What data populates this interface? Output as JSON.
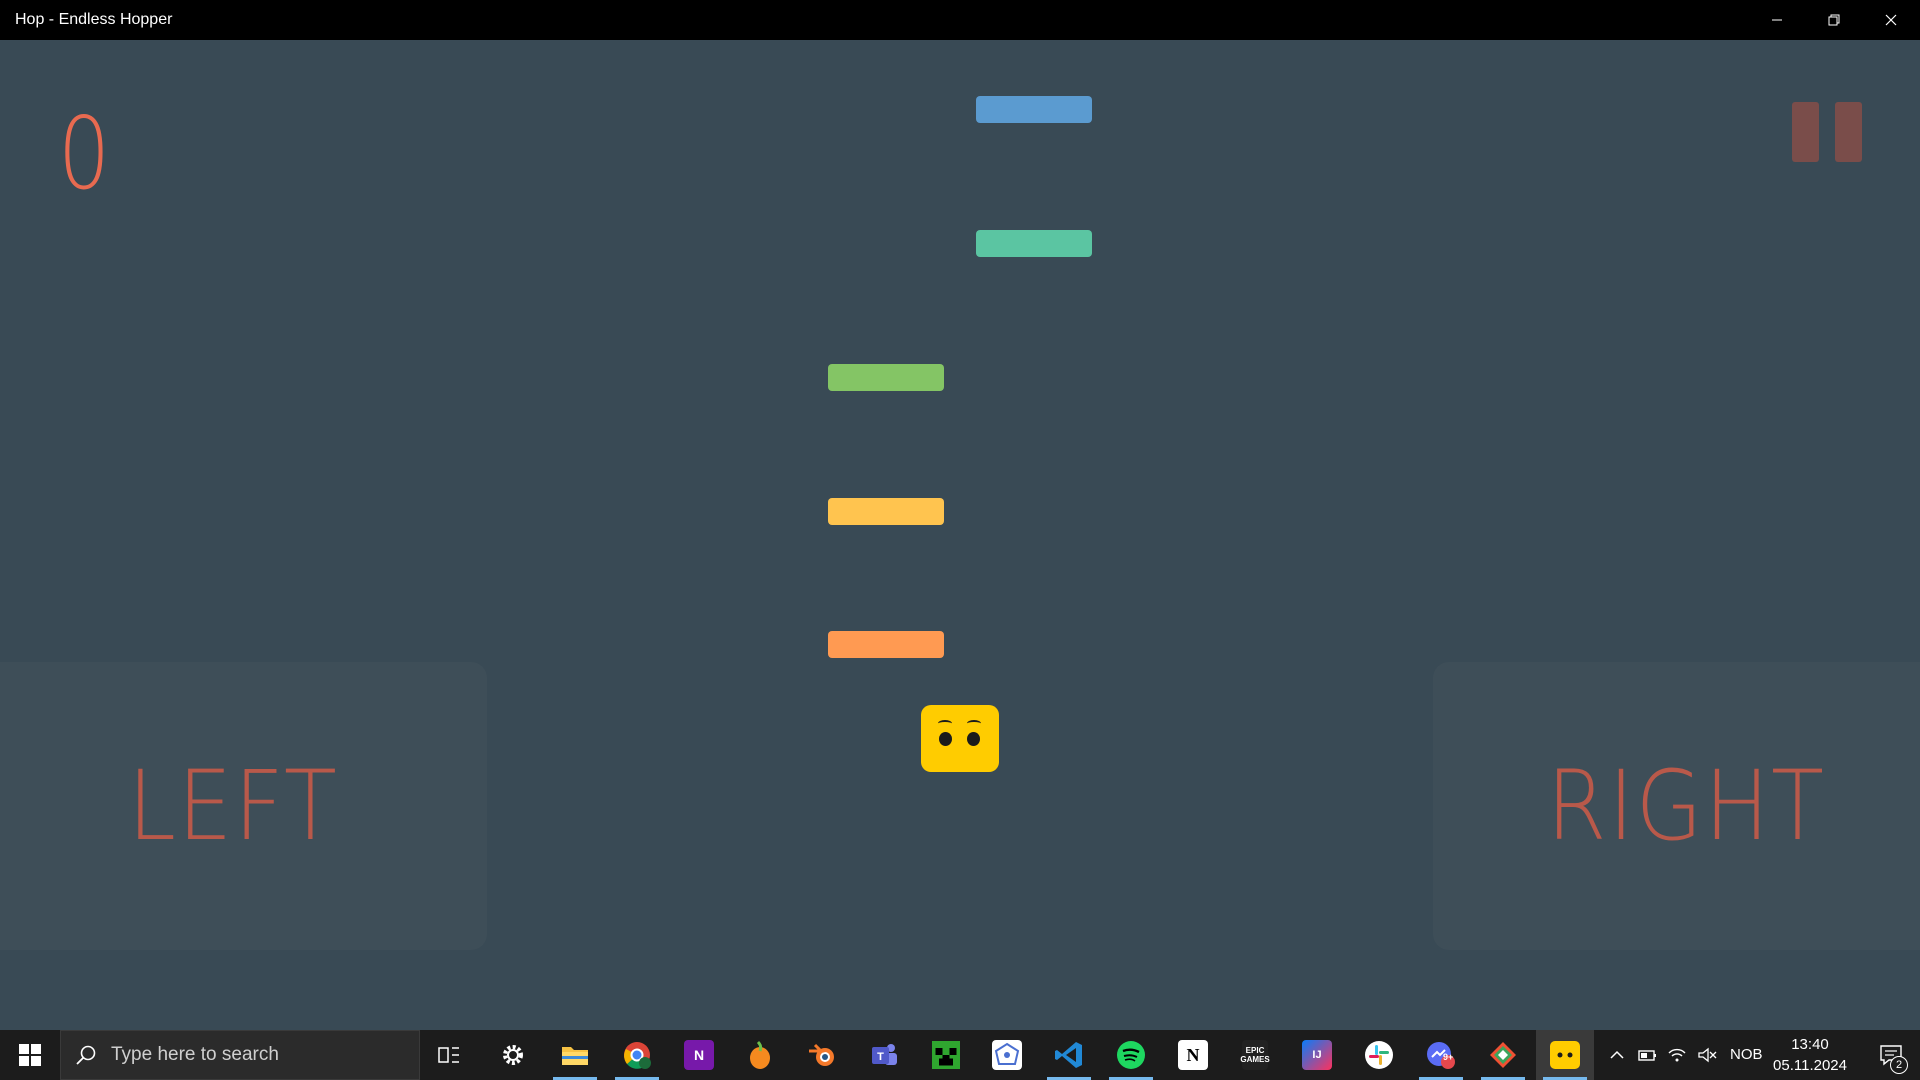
{
  "window": {
    "title": "Hop - Endless Hopper",
    "minimize_icon": "minimize-icon",
    "restore_icon": "restore-icon",
    "close_icon": "close-icon"
  },
  "game": {
    "score": "0",
    "pause_icon": "pause-icon",
    "left_label": "LEFT",
    "right_label": "RIGHT",
    "background_color": "#394a55",
    "platforms": [
      {
        "color": "#5b9bd0"
      },
      {
        "color": "#5bc5a2"
      },
      {
        "color": "#84c565"
      },
      {
        "color": "#ffc44f"
      },
      {
        "color": "#ff9a52"
      }
    ],
    "player_color": "#ffcc00"
  },
  "taskbar": {
    "search_placeholder": "Type here to search",
    "apps": [
      {
        "name": "task-view",
        "label": ""
      },
      {
        "name": "settings",
        "label": ""
      },
      {
        "name": "file-explorer",
        "label": ""
      },
      {
        "name": "chrome",
        "label": ""
      },
      {
        "name": "onenote",
        "label": "N"
      },
      {
        "name": "fl-studio",
        "label": ""
      },
      {
        "name": "blender",
        "label": ""
      },
      {
        "name": "teams",
        "label": ""
      },
      {
        "name": "minecraft",
        "label": ""
      },
      {
        "name": "app-polygon",
        "label": ""
      },
      {
        "name": "vscode",
        "label": ""
      },
      {
        "name": "spotify",
        "label": ""
      },
      {
        "name": "notion",
        "label": "N"
      },
      {
        "name": "epic-games",
        "label": "EPIC GAMES"
      },
      {
        "name": "intellij",
        "label": "IJ"
      },
      {
        "name": "slack",
        "label": ""
      },
      {
        "name": "messenger",
        "label": "9+"
      },
      {
        "name": "app-diamond",
        "label": ""
      },
      {
        "name": "hop-game",
        "label": ""
      }
    ],
    "language": "NOB",
    "time": "13:40",
    "date": "05.11.2024",
    "notification_count": "2"
  }
}
